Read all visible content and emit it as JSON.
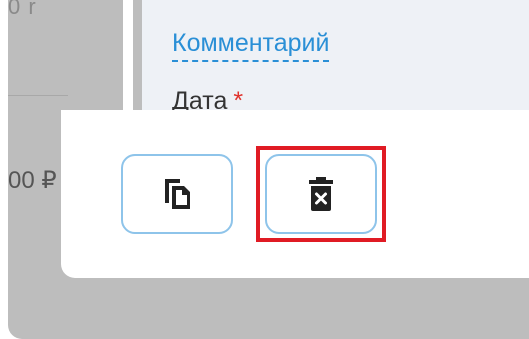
{
  "background": {
    "top_text": "0 r",
    "price_text": "00 ₽"
  },
  "form": {
    "comment_label": "Комментарий",
    "date_label": "Дата",
    "required_marker": "*"
  },
  "actions": {
    "copy_icon": "copy-icon",
    "delete_icon": "trash-icon"
  },
  "colors": {
    "accent": "#2a8fd6",
    "button_border": "#8ec4ea",
    "required": "#e0322c",
    "highlight": "#e01b24",
    "backdrop": "#bdbdbd"
  }
}
